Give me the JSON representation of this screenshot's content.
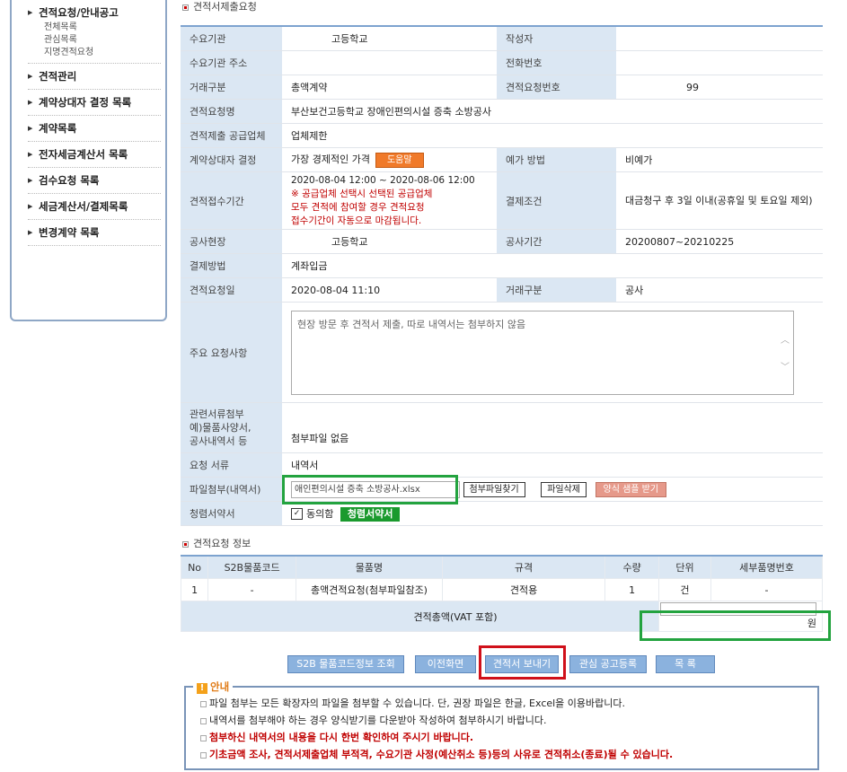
{
  "sidebar": {
    "items": [
      {
        "label": "견적요청/안내공고",
        "sub": [
          "전체목록",
          "관심목록",
          "지명견적요청"
        ]
      },
      {
        "label": "견적관리"
      },
      {
        "label": "계약상대자 결정 목록"
      },
      {
        "label": "계약목록"
      },
      {
        "label": "전자세금계산서 목록"
      },
      {
        "label": "검수요청 목록"
      },
      {
        "label": "세금계산서/결제목록"
      },
      {
        "label": "변경계약 목록"
      }
    ]
  },
  "section1_title": "견적서제출요청",
  "form": {
    "demand_org_label": "수요기관",
    "demand_org": "고등학교",
    "writer_label": "작성자",
    "writer": "",
    "org_addr_label": "수요기관 주소",
    "org_addr": "",
    "phone_label": "전화번호",
    "phone": "",
    "trade_type_label": "거래구분",
    "trade_type": "총액계약",
    "request_no_label": "견적요청번호",
    "request_no": "99",
    "request_name_label": "견적요청명",
    "request_name": "부산보건고등학교 장애인편의시설 증축 소방공사",
    "supplier_label": "견적제출 공급업체",
    "supplier": "업체제한",
    "contract_decision_label": "계약상대자 결정",
    "contract_decision": "가장 경제적인 가격",
    "help_button": "도움말",
    "price_method_label": "예가 방법",
    "price_method": "비예가",
    "period_label": "견적접수기간",
    "period": "2020-08-04 12:00 ~ 2020-08-06 12:00",
    "period_warning_1": "※ 공급업체 선택시 선택된 공급업체",
    "period_warning_2": "모두 견적에 참여할 경우 견적요청",
    "period_warning_3": "접수기간이 자동으로 마감됩니다.",
    "payment_cond_label": "결제조건",
    "payment_cond": "대금청구 후 3일 이내(공휴일 및 토요일 제외)",
    "site_label": "공사현장",
    "site": "고등학교",
    "work_period_label": "공사기간",
    "work_period": "20200807~20210225",
    "pay_method_label": "결제방법",
    "pay_method": "계좌입금",
    "request_date_label": "견적요청일",
    "request_date": "2020-08-04 11:10",
    "trade_type2_label": "거래구분",
    "trade_type2": "공사",
    "main_request_label": "주요 요청사항",
    "main_request": "현장 방문 후 견적서 제출, 따로 내역서는 첨부하지 않음",
    "attach_label_1": "관련서류첨부",
    "attach_label_2": "예)물품사양서,",
    "attach_label_3": "공사내역서 등",
    "attach": "첨부파일 없음",
    "req_doc_label": "요청 서류",
    "req_doc": "내역서",
    "file_label": "파일첨부(내역서)",
    "file_value": "애인편의시설 증축 소방공사.xlsx",
    "find_button": "첨부파일찾기",
    "delete_button": "파일삭제",
    "sample_button": "양식 샘플 받기",
    "pledge_label": "청렴서약서",
    "agree_label": "동의함",
    "pledge_button": "청렴서약서",
    "agree_check": "✓"
  },
  "section2_title": "견적요청 정보",
  "items": {
    "headers": [
      "No",
      "S2B물품코드",
      "물품명",
      "규격",
      "수량",
      "단위",
      "세부품명번호"
    ],
    "rows": [
      [
        "1",
        "-",
        "총액견적요청(첨부파일참조)",
        "견적용",
        "1",
        "건",
        "-"
      ]
    ],
    "total_label": "견적총액(VAT 포함)",
    "total_value": "",
    "currency": "원"
  },
  "buttons": {
    "code_lookup": "S2B 물품코드정보 조회",
    "prev": "이전화면",
    "send": "견적서 보내기",
    "interest": "관심 공고등록",
    "list": "목 록"
  },
  "notice": {
    "title": "안내",
    "lines": [
      "파일 첨부는 모든 확장자의 파일을 첨부할 수 있습니다. 단, 권장 파일은 한글, Excel을 이용바랍니다.",
      "내역서를 첨부해야 하는 경우 양식받기를 다운받아 작성하여 첨부하시기 바랍니다.",
      "첨부하신 내역서의 내용을 다시 한번 확인하여 주시기 바랍니다.",
      "기초금액 조사, 견적서제출업체 부적격, 수요기관 사정(예산취소 등)등의 사유로 견적취소(종료)될 수 있습니다."
    ]
  }
}
